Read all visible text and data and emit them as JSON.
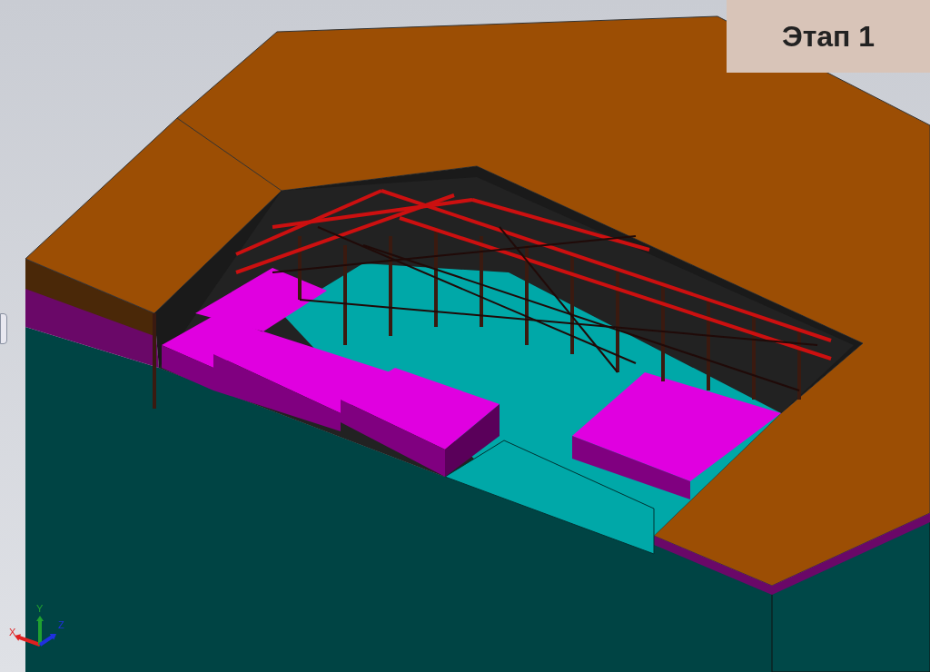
{
  "stage_label": "Этап 1",
  "triad": {
    "axes": [
      {
        "label": "X",
        "color": "#e02020"
      },
      {
        "label": "Y",
        "color": "#20a030"
      },
      {
        "label": "Z",
        "color": "#2030e0"
      }
    ]
  }
}
